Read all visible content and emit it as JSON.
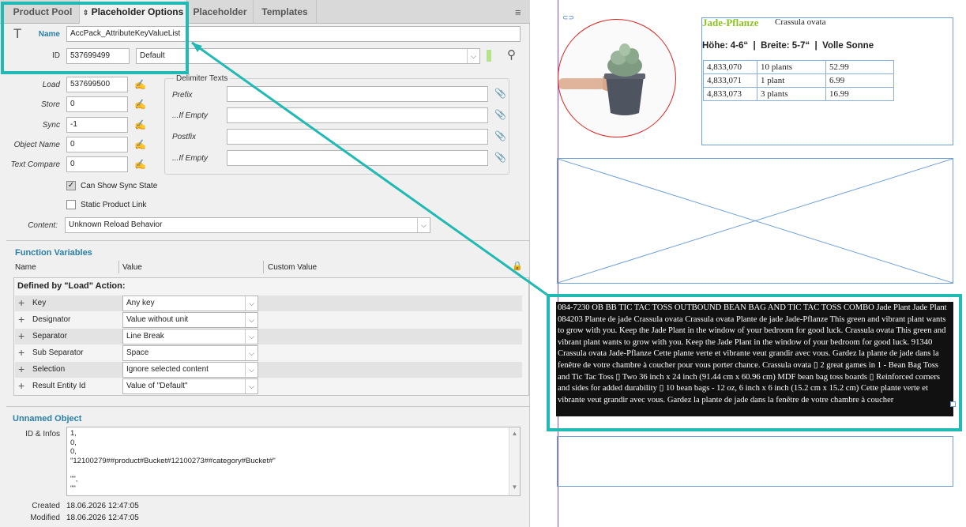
{
  "tabs": [
    {
      "label": "Product Pool"
    },
    {
      "label": "Placeholder Options"
    },
    {
      "label": "Placeholder"
    },
    {
      "label": "Templates"
    }
  ],
  "name": {
    "label": "Name",
    "value": "AccPack_AttributeKeyValueList"
  },
  "id": {
    "label": "ID",
    "value": "537699499",
    "dropdown": "Default"
  },
  "fields": [
    {
      "label": "Load",
      "value": "537699500"
    },
    {
      "label": "Store",
      "value": "0"
    },
    {
      "label": "Sync",
      "value": "-1"
    },
    {
      "label": "Object Name",
      "value": "0"
    },
    {
      "label": "Text Compare",
      "value": "0"
    }
  ],
  "delimiter": {
    "title": "Delimiter Texts",
    "items": [
      {
        "label": "Prefix"
      },
      {
        "label": "...If Empty"
      },
      {
        "label": "Postfix"
      },
      {
        "label": "...If Empty"
      }
    ]
  },
  "checkboxes": [
    {
      "label": "Can Show Sync State",
      "checked": true
    },
    {
      "label": "Static Product Link",
      "checked": false
    }
  ],
  "content": {
    "label": "Content:",
    "value": "Unknown Reload Behavior"
  },
  "function_vars": {
    "title": "Function Variables",
    "headers": [
      "Name",
      "Value",
      "Custom Value"
    ],
    "group": "Defined by \"Load\" Action:",
    "rows": [
      {
        "name": "Key",
        "value": "Any key"
      },
      {
        "name": "Designator",
        "value": "Value without unit"
      },
      {
        "name": "Separator",
        "value": "Line Break"
      },
      {
        "name": "Sub Separator",
        "value": "Space"
      },
      {
        "name": "Selection",
        "value": "Ignore selected content"
      },
      {
        "name": "Result Entity Id",
        "value": "Value of \"Default\""
      }
    ]
  },
  "unnamed": {
    "title": "Unnamed Object",
    "infos_label": "ID & Infos",
    "infos_lines": [
      "1,",
      "0,",
      "0,",
      "\"12100279##product#Bucket#12100273##category#Bucket#\"",
      "",
      "\"\",",
      "\"\""
    ],
    "created_label": "Created",
    "created": "18.06.2026 12:47:05",
    "modified_label": "Modified",
    "modified": "18.06.2026 12:47:05"
  },
  "page": {
    "product_title": "Jade-Pflanze",
    "product_sub": "Crassula ovata",
    "specs": "Höhe: 4-6“  |  Breite: 5-7“  |  Volle Sonne",
    "table": [
      [
        "4,833,070",
        "10 plants",
        "52.99"
      ],
      [
        "4,833,071",
        "1 plant",
        "6.99"
      ],
      [
        "4,833,073",
        "3 plants",
        "16.99"
      ]
    ],
    "body_text": "084-7230 OB BB TIC TAC TOSS OUTBOUND BEAN BAG AND TIC TAC TOSS COMBO Jade Plant Jade Plant 084203 Plante de jade Crassula ovata Crassula ovata Plante de jade Jade-Pflanze This green and vibrant plant wants to grow with you. Keep the Jade Plant in the window of your bedroom for good luck.  Crassula ovata This green and vibrant plant wants to grow with you. Keep the Jade Plant in the window of your bedroom for good luck.  91340 Crassula ovata Jade-Pflanze Cette plante verte et vibrante veut grandir avec vous. Gardez la plante de jade dans la fenêtre de votre chambre à coucher pour vous porter chance. Crassula ovata ▯ 2 great games in 1 - Bean Bag Toss and Tic Tac Toss ▯ Two 36 inch x 24 inch (91.44 cm x 60.96 cm) MDF bean bag toss boards ▯ Reinforced corners and sides for added durability ▯ 10 bean bags - 12 oz, 6 inch x 6 inch (15.2 cm x 15.2 cm) Cette plante verte et vibrante veut grandir avec vous. Gardez la plante de jade dans la fenêtre de votre chambre à coucher"
  },
  "colors": {
    "accent": "#2a7fa8",
    "callout": "#20b9b3",
    "title_green": "#8dc21f"
  }
}
